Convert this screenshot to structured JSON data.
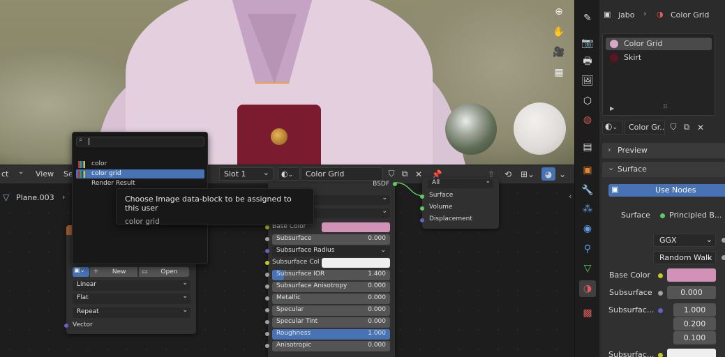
{
  "viewport_tools": [
    {
      "icon": "zoom-icon",
      "glyph": "⊕"
    },
    {
      "icon": "hand-icon",
      "glyph": "✋"
    },
    {
      "icon": "camera-icon",
      "glyph": "🎥"
    },
    {
      "icon": "grid-icon",
      "glyph": "▦"
    }
  ],
  "node_header": {
    "editor_fragment": "ct",
    "view": "View",
    "select_fragment": "Se",
    "slot": "Slot 1",
    "material_name": "Color Grid",
    "object_name": "Plane.003"
  },
  "image_node": {
    "new_label": "New",
    "open_label": "Open",
    "interpolation": "Linear",
    "projection": "Flat",
    "extension": "Repeat",
    "vector_label": "Vector"
  },
  "dropdown": {
    "search_value": "",
    "items": [
      {
        "label": "color",
        "selected": false,
        "thumb": true
      },
      {
        "label": "color grid",
        "selected": true,
        "thumb": true
      },
      {
        "label": "Render Result",
        "selected": false,
        "thumb": false
      }
    ]
  },
  "tooltip": {
    "title": "Choose Image data-block to be assigned to this user",
    "subtitle": "color grid"
  },
  "bsdf_node": {
    "header_fragment": "BSDF",
    "rows": [
      {
        "label": "Base Color",
        "value": "",
        "type": "color",
        "color": "#d291b7",
        "socket": "#c7c729"
      },
      {
        "label": "Subsurface",
        "value": "0.000",
        "type": "slider",
        "socket": "#a1a1a1"
      },
      {
        "label": "Subsurface Radius",
        "value": "",
        "type": "dropdown",
        "socket": "#6363c7"
      },
      {
        "label": "Subsurface Col",
        "value": "",
        "type": "color",
        "color": "#efefef",
        "socket": "#c7c729"
      },
      {
        "label": "Subsurface IOR",
        "value": "1.400",
        "type": "slider",
        "fill": 0.1,
        "socket": "#a1a1a1"
      },
      {
        "label": "Subsurface Anisotropy",
        "value": "0.000",
        "type": "slider",
        "socket": "#a1a1a1"
      },
      {
        "label": "Metallic",
        "value": "0.000",
        "type": "slider",
        "socket": "#a1a1a1"
      },
      {
        "label": "Specular",
        "value": "0.000",
        "type": "slider",
        "socket": "#a1a1a1"
      },
      {
        "label": "Specular Tint",
        "value": "0.000",
        "type": "slider",
        "socket": "#a1a1a1"
      },
      {
        "label": "Roughness",
        "value": "1.000",
        "type": "slider",
        "fill": 1.0,
        "socket": "#a1a1a1"
      },
      {
        "label": "Anisotropic",
        "value": "0.000",
        "type": "slider",
        "socket": "#a1a1a1"
      }
    ]
  },
  "output_node": {
    "target": "All",
    "sockets": [
      "Surface",
      "Volume",
      "Displacement"
    ]
  },
  "properties": {
    "breadcrumb_object": "jabo",
    "breadcrumb_material": "Color Grid",
    "material_slots": [
      {
        "name": "Color Grid",
        "active": true,
        "color": "#d9a7c7"
      },
      {
        "name": "Skirt",
        "active": false,
        "color": "#5a1424"
      }
    ],
    "material_field": "Color Gr...",
    "preview_label": "Preview",
    "surface_panel": "Surface",
    "use_nodes": "Use Nodes",
    "surface_label": "Surface",
    "surface_value": "Principled B...",
    "distribution": "GGX",
    "subsurface_method": "Random Walk",
    "base_color_label": "Base Color",
    "base_color": "#d291b7",
    "subsurface_label": "Subsurface",
    "subsurface_value": "0.000",
    "subsurface_radius_label": "Subsurfac...",
    "radius_values": [
      "1.000",
      "0.200",
      "0.100"
    ],
    "subsurface_color_label": "Subsurfac..."
  }
}
